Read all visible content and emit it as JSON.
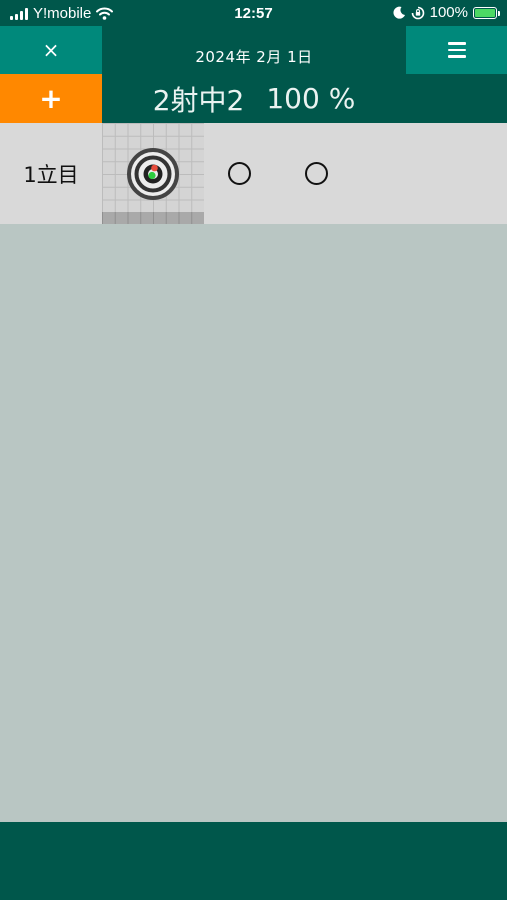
{
  "status_bar": {
    "carrier": "Y!mobile",
    "time": "12:57",
    "battery_percent": "100%",
    "icons": [
      "signal-icon",
      "wifi-icon",
      "moon-icon",
      "orientation-lock-icon",
      "battery-charging-icon"
    ]
  },
  "header": {
    "close_label": "×",
    "date": "2024年 2月 1日",
    "add_label": "+",
    "score_text": "2射中2",
    "percent_text": "100 %"
  },
  "rounds": [
    {
      "label": "1立目",
      "shots": [
        "target-hit",
        "〇",
        "〇"
      ]
    }
  ],
  "colors": {
    "header_bg": "#00574b",
    "button_teal": "#00897b",
    "add_orange": "#ff8800",
    "content_bg": "#b9c6c3",
    "row_bg": "#d9d9d9",
    "hit_green": "#2ecc40",
    "hit_red": "#e74c3c"
  }
}
